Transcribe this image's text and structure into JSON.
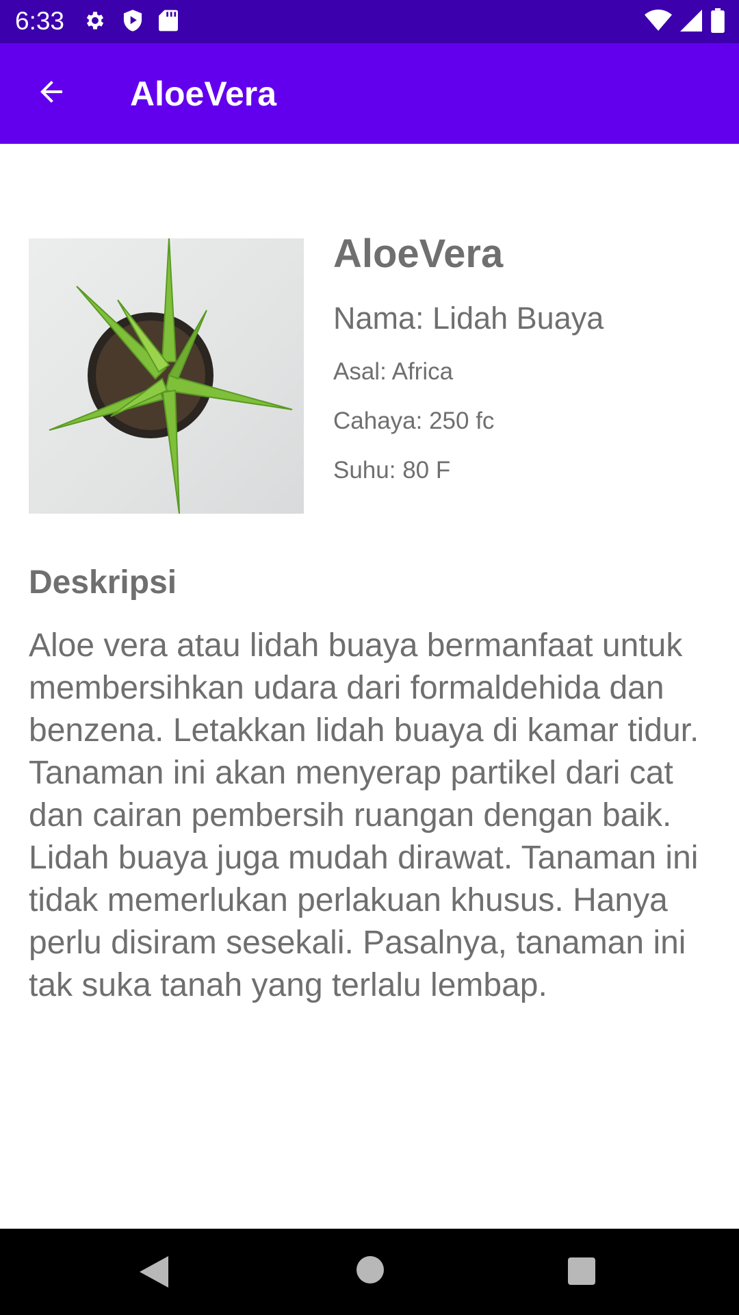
{
  "status_bar": {
    "time": "6:33",
    "icons_left": [
      "gear-icon",
      "shield-play-icon",
      "sd-card-icon"
    ],
    "icons_right": [
      "wifi-icon",
      "signal-icon",
      "battery-icon"
    ],
    "background": "#3c00ad"
  },
  "app_bar": {
    "title": "AloeVera",
    "back_icon": "arrow-back-icon",
    "background": "#6200ee"
  },
  "plant": {
    "name": "AloeVera",
    "local_name": "Nama: Lidah Buaya",
    "origin": "Asal: Africa",
    "light": "Cahaya: 250 fc",
    "temperature": "Suhu: 80 F",
    "image": "aloe-vera-plant-photo"
  },
  "description": {
    "title": "Deskripsi",
    "text": "Aloe vera atau lidah buaya bermanfaat untuk membersihkan udara dari formaldehida dan benzena. Letakkan lidah buaya di kamar tidur. Tanaman ini akan menyerap partikel dari cat dan cairan pembersih ruangan dengan baik. Lidah buaya juga mudah dirawat. Tanaman ini tidak memerlukan perlakuan khusus. Hanya perlu disiram sesekali. Pasalnya, tanaman ini tak suka tanah yang terlalu lembap."
  },
  "nav_bar": {
    "buttons": [
      "nav-back-icon",
      "nav-home-icon",
      "nav-recents-icon"
    ]
  }
}
